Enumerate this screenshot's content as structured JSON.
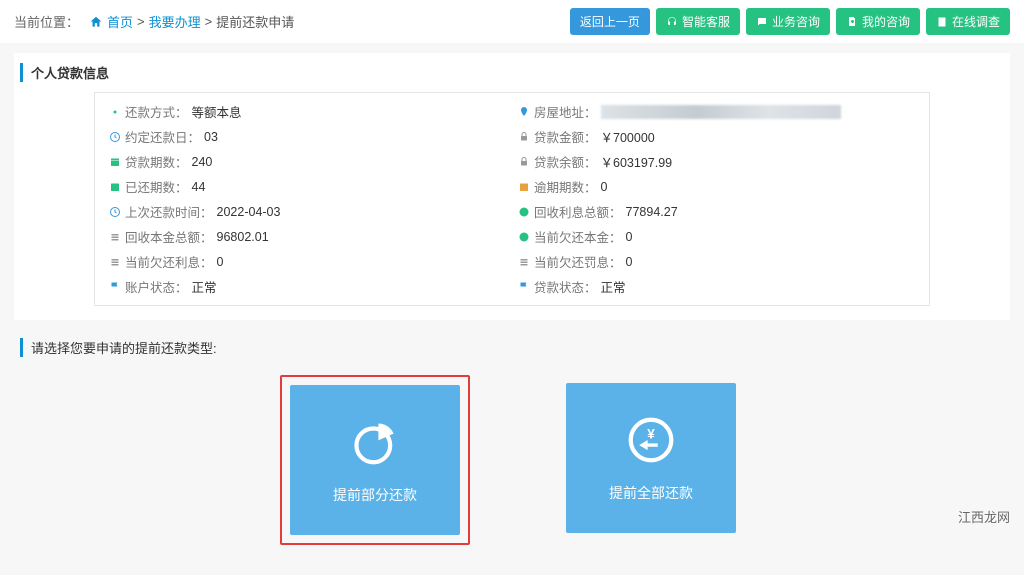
{
  "breadcrumb": {
    "label": "当前位置：",
    "home": "首页",
    "sep1": ">",
    "p1": "我要办理",
    "sep2": ">",
    "p2": "提前还款申请"
  },
  "topButtons": {
    "back": "返回上一页",
    "smart": "智能客服",
    "consult": "业务咨询",
    "mine": "我的咨询",
    "survey": "在线调查"
  },
  "panel": {
    "title": "个人贷款信息"
  },
  "info": {
    "repayMethod": {
      "label": "还款方式：",
      "value": "等额本息"
    },
    "houseAddr": {
      "label": "房屋地址：",
      "value": ""
    },
    "repayDay": {
      "label": "约定还款日：",
      "value": "03"
    },
    "loanAmt": {
      "label": "贷款金额：",
      "value": "￥700000"
    },
    "periods": {
      "label": "贷款期数：",
      "value": "240"
    },
    "balance": {
      "label": "贷款余额：",
      "value": "￥603197.99"
    },
    "paidPeriods": {
      "label": "已还期数：",
      "value": "44"
    },
    "overdue": {
      "label": "逾期期数：",
      "value": "0"
    },
    "lastDate": {
      "label": "上次还款时间：",
      "value": "2022-04-03"
    },
    "interestTotal": {
      "label": "回收利息总额：",
      "value": "77894.27"
    },
    "principalTotal": {
      "label": "回收本金总额：",
      "value": "96802.01"
    },
    "owePrincipal": {
      "label": "当前欠还本金：",
      "value": "0"
    },
    "oweInterest": {
      "label": "当前欠还利息：",
      "value": "0"
    },
    "owePenalty": {
      "label": "当前欠还罚息：",
      "value": "0"
    },
    "acctStatus": {
      "label": "账户状态：",
      "value": "正常"
    },
    "loanStatus": {
      "label": "贷款状态：",
      "value": "正常"
    }
  },
  "choose": {
    "title": "请选择您要申请的提前还款类型:"
  },
  "cards": {
    "partial": "提前部分还款",
    "full": "提前全部还款"
  },
  "watermark": "江西龙网"
}
